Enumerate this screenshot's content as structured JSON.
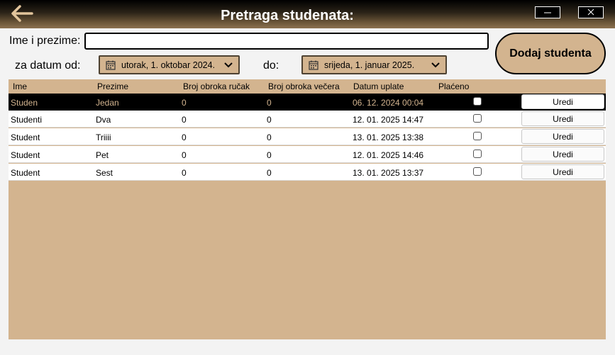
{
  "window": {
    "title": "Pretraga studenata:",
    "back_icon": "arrow-left-icon",
    "minimize_icon": "minimize-icon",
    "close_icon": "close-icon",
    "accent": "#d3b48f",
    "back_arrow_color": "#e2c59c"
  },
  "search": {
    "name_label": "Ime i prezime:",
    "name_value": "",
    "from_label": "za datum od:",
    "from_value": "utorak, 1. oktobar 2024.",
    "to_label": "do:",
    "to_value": "srijeda, 1. januar 2025."
  },
  "actions": {
    "add_student": "Dodaj studenta"
  },
  "table": {
    "columns": [
      "Ime",
      "Prezime",
      "Broj obroka ručak",
      "Broj obroka večera",
      "Datum uplate",
      "Plaćeno"
    ],
    "rows": [
      {
        "ime": "Studen",
        "prezime": "Jedan",
        "rucak": "0",
        "vecera": "0",
        "datum": "06. 12. 2024 00:04",
        "placeno": false,
        "action": "Uredi",
        "selected": true
      },
      {
        "ime": "Studenti",
        "prezime": "Dva",
        "rucak": "0",
        "vecera": "0",
        "datum": "12. 01. 2025 14:47",
        "placeno": false,
        "action": "Uredi",
        "selected": false
      },
      {
        "ime": "Student",
        "prezime": "Triiii",
        "rucak": "0",
        "vecera": "0",
        "datum": "13. 01. 2025 13:38",
        "placeno": false,
        "action": "Uredi",
        "selected": false
      },
      {
        "ime": "Student",
        "prezime": "Pet",
        "rucak": "0",
        "vecera": "0",
        "datum": "12. 01. 2025 14:46",
        "placeno": false,
        "action": "Uredi",
        "selected": false
      },
      {
        "ime": "Student",
        "prezime": "Sest",
        "rucak": "0",
        "vecera": "0",
        "datum": "13. 01. 2025 13:37",
        "placeno": false,
        "action": "Uredi",
        "selected": false
      }
    ]
  }
}
